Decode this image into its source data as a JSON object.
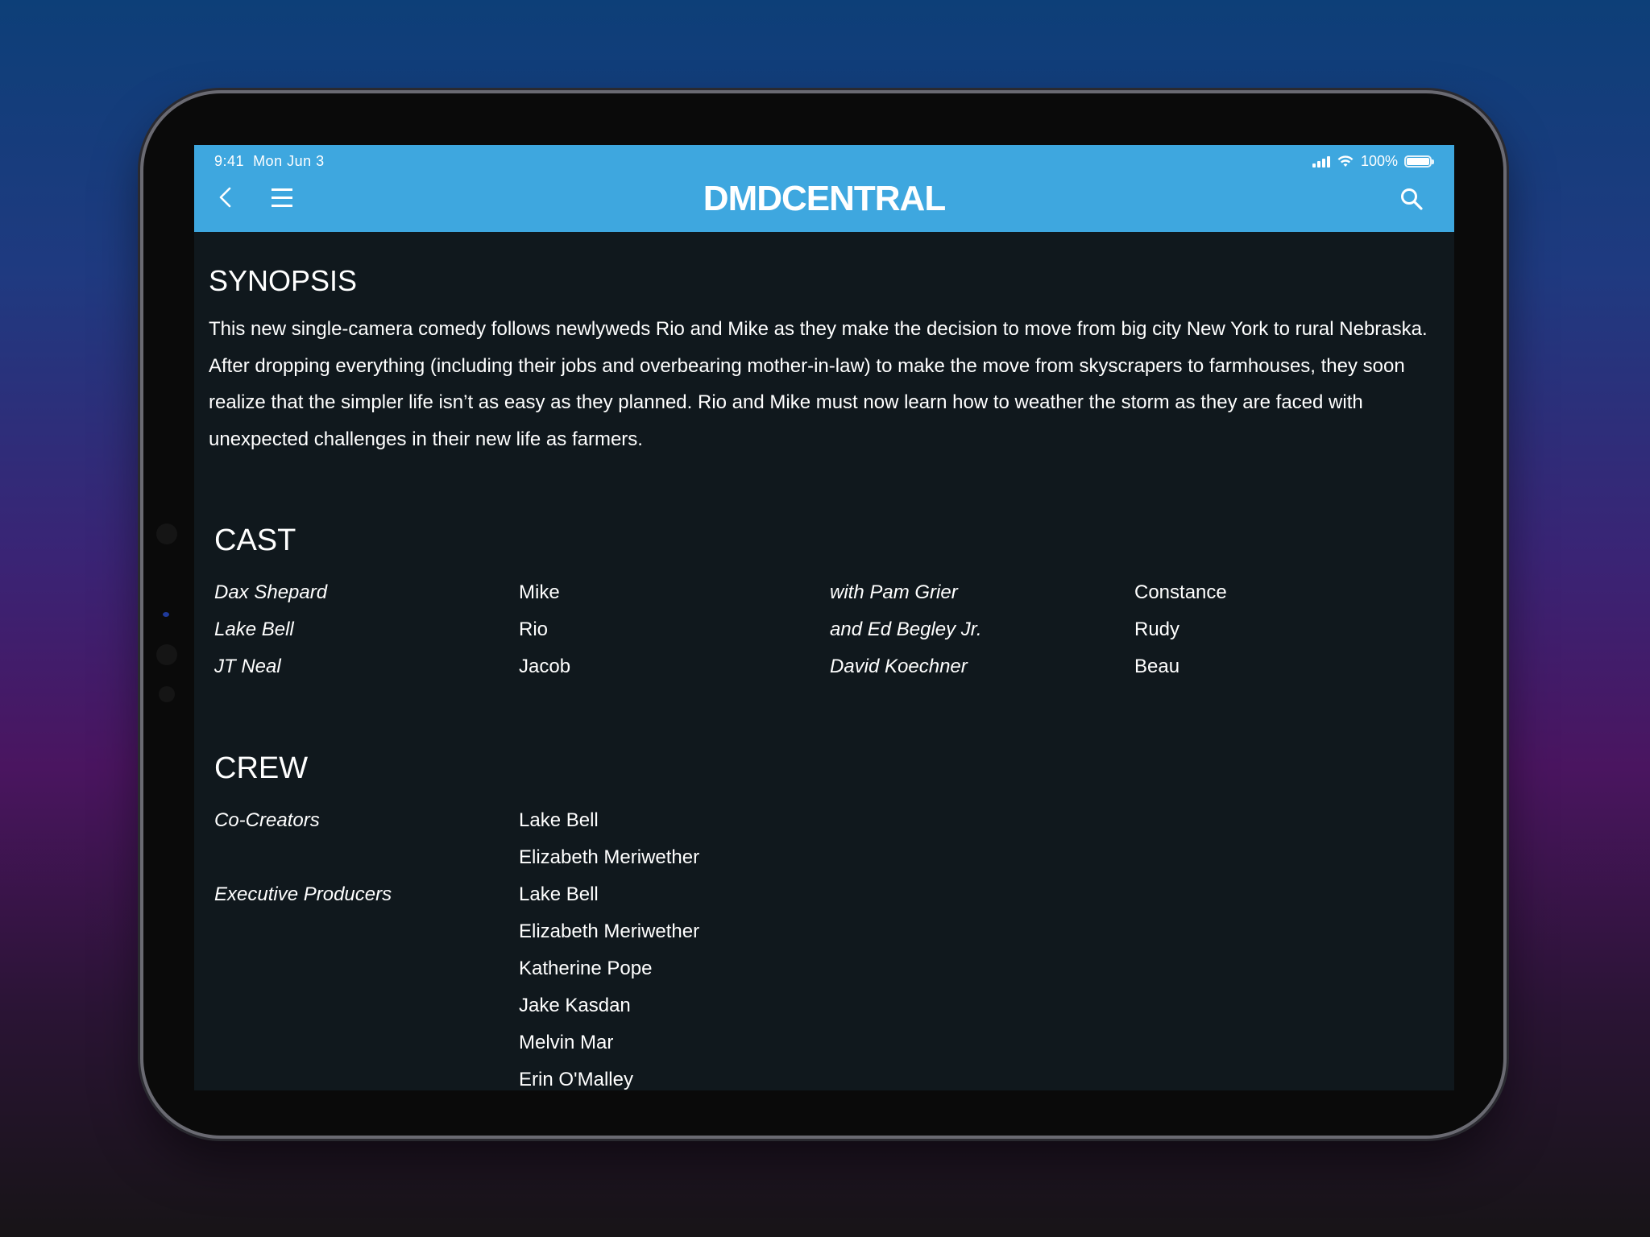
{
  "status_bar": {
    "time": "9:41",
    "date": "Mon Jun 3",
    "battery": "100%"
  },
  "header": {
    "logo": "DMDCENTRAL"
  },
  "synopsis": {
    "heading": "SYNOPSIS",
    "text": "This new single-camera comedy follows newlyweds Rio and Mike as they make the decision to move from big city New York to rural Nebraska. After dropping everything (including their jobs and overbearing mother-in-law) to make the move from skyscrapers to farmhouses, they soon realize that the simpler life isn’t as easy as they planned. Rio and Mike must now learn how to weather the storm as they are faced with unexpected challenges in their new life as farmers."
  },
  "cast": {
    "heading": "CAST",
    "rows": [
      {
        "actor": "Dax Shepard",
        "role": "Mike",
        "actor2": "with Pam Grier",
        "role2": "Constance"
      },
      {
        "actor": "Lake Bell",
        "role": "Rio",
        "actor2": "and Ed Begley Jr.",
        "role2": "Rudy"
      },
      {
        "actor": "JT Neal",
        "role": "Jacob",
        "actor2": "David Koechner",
        "role2": "Beau"
      }
    ]
  },
  "crew": {
    "heading": "CREW",
    "co_creators_label": "Co-Creators",
    "co_creators": [
      "Lake Bell",
      "Elizabeth Meriwether"
    ],
    "exec_producers_label": "Executive Producers",
    "exec_producers": [
      "Lake Bell",
      "Elizabeth Meriwether",
      "Katherine Pope",
      "Jake Kasdan",
      "Melvin Mar",
      "Erin O'Malley"
    ]
  }
}
